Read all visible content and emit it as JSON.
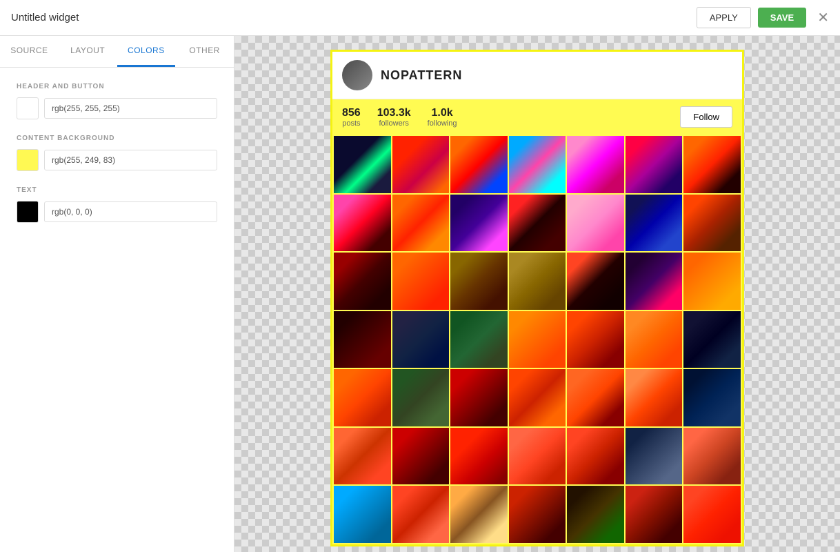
{
  "topbar": {
    "title": "Untitled widget",
    "apply_label": "APPLY",
    "save_label": "SAVE",
    "close_symbol": "✕"
  },
  "sidebar": {
    "tabs": [
      {
        "id": "source",
        "label": "SOURCE"
      },
      {
        "id": "layout",
        "label": "LAYOUT"
      },
      {
        "id": "colors",
        "label": "COLORS"
      },
      {
        "id": "other",
        "label": "OTHER"
      }
    ],
    "active_tab": "colors",
    "sections": {
      "header_button": {
        "label": "HEADER AND BUTTON",
        "color_value": "rgb(255, 255, 255)",
        "swatch_color": "#ffffff"
      },
      "content_background": {
        "label": "CONTENT BACKGROUND",
        "color_value": "rgb(255, 249, 83)",
        "swatch_color": "#fff953"
      },
      "text": {
        "label": "TEXT",
        "color_value": "rgb(0, 0, 0)",
        "swatch_color": "#000000"
      }
    }
  },
  "widget": {
    "username": "NOPATTERN",
    "avatar_alt": "nopattern avatar",
    "stats": {
      "posts": {
        "value": "856",
        "label": "posts"
      },
      "followers": {
        "value": "103.3k",
        "label": "followers"
      },
      "following": {
        "value": "1.0k",
        "label": "following"
      }
    },
    "follow_label": "Follow",
    "border_color": "#f5f311"
  },
  "photos": {
    "count": 49,
    "classes": [
      "p1",
      "p2",
      "p3",
      "p4",
      "p5",
      "p6",
      "p7",
      "p8",
      "p9",
      "p10",
      "p11",
      "p12",
      "p13",
      "p14",
      "p15",
      "p16",
      "p17",
      "p18",
      "p19",
      "p20",
      "p21",
      "p22",
      "p23",
      "p24",
      "p25",
      "p26",
      "p27",
      "p28",
      "p29",
      "p30",
      "p31",
      "p32",
      "p33",
      "p34",
      "p35",
      "p36",
      "p37",
      "p38",
      "p39",
      "p40",
      "p41",
      "p42",
      "p43",
      "p44",
      "p45",
      "p46",
      "p47",
      "p48",
      "p49"
    ]
  }
}
